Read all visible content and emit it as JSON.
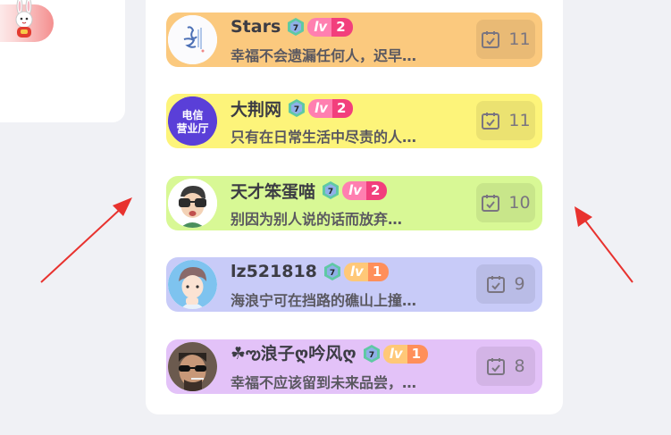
{
  "colors": {
    "background": "#f0f1f5",
    "panel": "#ffffff",
    "arrow": "#e8322e"
  },
  "ranking": [
    {
      "name": "Stars",
      "verify_level": "7",
      "level_prefix": "lv",
      "level": "2",
      "level_style": "pink",
      "signature": "幸福不会遗漏任何人，迟早…",
      "checkin_icon": "calendar-check-icon",
      "checkin_count": "11",
      "row_color": "#fbc97e"
    },
    {
      "name": "大荆网",
      "verify_level": "7",
      "level_prefix": "lv",
      "level": "2",
      "level_style": "pink",
      "signature": "只有在日常生活中尽责的人…",
      "checkin_icon": "calendar-check-icon",
      "checkin_count": "11",
      "row_color": "#fdf47a"
    },
    {
      "name": "天才笨蛋喵",
      "verify_level": "7",
      "level_prefix": "lv",
      "level": "2",
      "level_style": "pink",
      "signature": "别因为别人说的话而放弃…",
      "checkin_icon": "calendar-check-icon",
      "checkin_count": "10",
      "row_color": "#d8f895"
    },
    {
      "name": "lz521818",
      "verify_level": "7",
      "level_prefix": "lv",
      "level": "1",
      "level_style": "orange",
      "signature": "海浪宁可在挡路的礁山上撞…",
      "checkin_icon": "calendar-check-icon",
      "checkin_count": "9",
      "row_color": "#c8cbf8"
    },
    {
      "name": "☘ఌ浪子ღ吟风ღ",
      "verify_level": "7",
      "level_prefix": "lv",
      "level": "1",
      "level_style": "orange",
      "signature": "幸福不应该留到未来品尝，…",
      "checkin_icon": "calendar-check-icon",
      "checkin_count": "8",
      "row_color": "#e3c2f8"
    }
  ],
  "avatar_texts": {
    "telecom_line1": "电信",
    "telecom_line2": "营业厅"
  }
}
